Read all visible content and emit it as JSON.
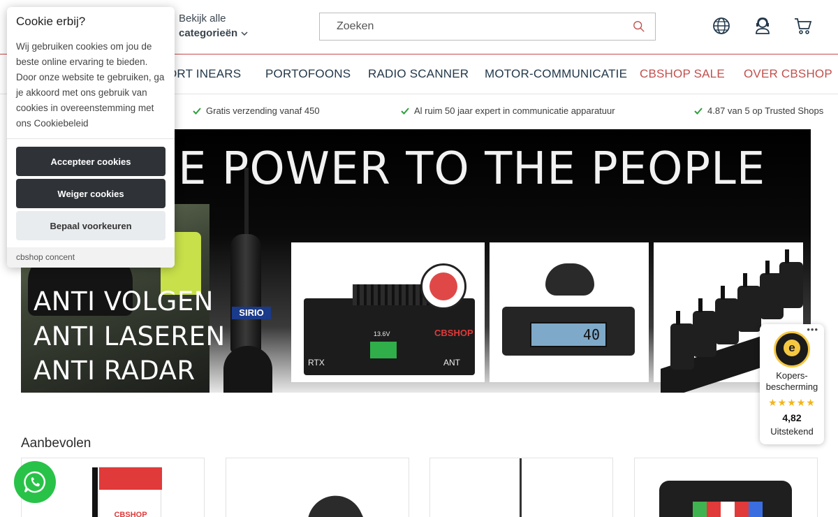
{
  "header": {
    "categories_line1": "Bekijk alle",
    "categories_line2": "categorieën",
    "search_placeholder": "Zoeken"
  },
  "nav": {
    "items": [
      {
        "label": "ORT INEARS"
      },
      {
        "label": "PORTOFOONS"
      },
      {
        "label": "RADIO SCANNER"
      },
      {
        "label": "MOTOR-COMMUNICATIE"
      },
      {
        "label": "CBSHOP SALE"
      },
      {
        "label": "OVER CBSHOP"
      }
    ]
  },
  "usp": [
    {
      "text": "Gratis verzending vanaf 450"
    },
    {
      "text": "Al ruim 50 jaar expert in communicatie apparatuur"
    },
    {
      "text": "4.87 van 5 op Trusted Shops"
    }
  ],
  "hero": {
    "title": "E POWER TO THE PEOPLE",
    "anti_lines": [
      "ANTI VOLGEN",
      "ANTI LASEREN",
      "ANTI RADAR"
    ],
    "sirio_label": "SIRIO",
    "amp_labels": [
      "RTX",
      "13.6V",
      "ANT"
    ],
    "radio_display": "40",
    "logo_text": "CBSHOP"
  },
  "cookie": {
    "title": "Cookie erbij?",
    "text": "Wij gebruiken cookies om jou de beste online ervaring te bieden. Door onze website te gebruiken, ga je akkoord met ons gebruik van cookies in overeenstemming met ons Cookiebeleid",
    "accept_label": "Accepteer cookies",
    "decline_label": "Weiger cookies",
    "prefs_label": "Bepaal voorkeuren",
    "footer": "cbshop concent"
  },
  "section": {
    "title": "Aanbevolen",
    "flag_brand": "CBSHOP"
  },
  "trust_badge": {
    "dots": "•••",
    "seal_letter": "e",
    "line1": "Kopers-",
    "line2": "bescherming",
    "stars": "★★★★★",
    "score": "4,82",
    "label": "Uitstekend"
  },
  "colors": {
    "accent_red": "#c0504d",
    "nav_text": "#22384a",
    "button_dark": "#2f3338",
    "whatsapp_green": "#29c248",
    "check_green": "#2e9e3e"
  }
}
